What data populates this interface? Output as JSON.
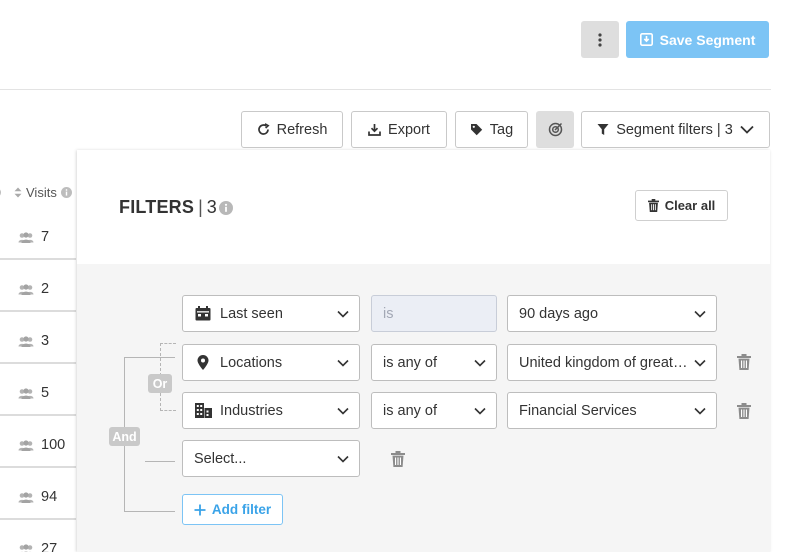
{
  "header": {
    "more_icon": "vertical-ellipsis-icon",
    "save_label": "Save Segment",
    "save_icon": "save-icon",
    "accent_color": "#7cc4f5"
  },
  "toolbar": {
    "refresh_label": "Refresh",
    "export_label": "Export",
    "tag_label": "Tag",
    "segment_filters_label": "Segment filters | 3"
  },
  "table": {
    "visits_header": "Visits",
    "rows": [
      "7",
      "2",
      "3",
      "5",
      "100",
      "94",
      "27"
    ]
  },
  "filters": {
    "title": "FILTERS",
    "separator": "|",
    "count": "3",
    "clear_label": "Clear all",
    "and_label": "And",
    "or_label": "Or",
    "rows": [
      {
        "field": "Last seen",
        "field_icon": "calendar-icon",
        "operator": "is",
        "value": "90 days ago"
      },
      {
        "field": "Locations",
        "field_icon": "map-pin-icon",
        "operator": "is any of",
        "value": "United kingdom of great britain and northern ireland"
      },
      {
        "field": "Industries",
        "field_icon": "building-icon",
        "operator": "is any of",
        "value": "Financial Services"
      }
    ],
    "empty_select_placeholder": "Select...",
    "add_filter_label": "Add filter"
  }
}
